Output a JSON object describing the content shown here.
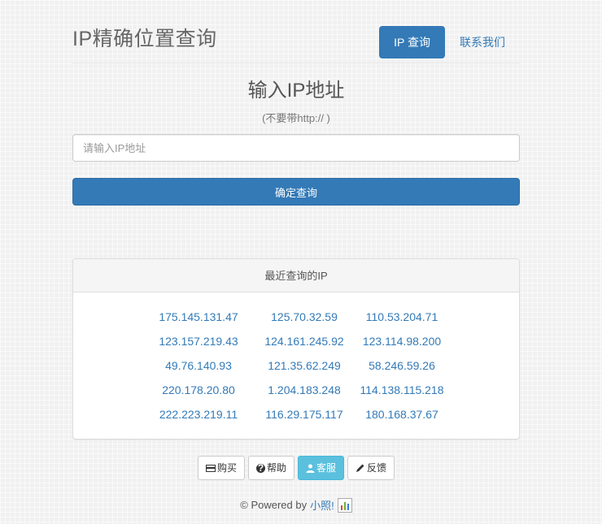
{
  "header": {
    "brand": "IP精确位置查询",
    "nav": [
      {
        "label": "IP 查询",
        "active": true
      },
      {
        "label": "联系我们",
        "active": false
      }
    ]
  },
  "form": {
    "title": "输入IP地址",
    "subtitle": "(不要带http:// )",
    "input_placeholder": "请输入IP地址",
    "input_value": "",
    "submit_label": "确定查询"
  },
  "recent": {
    "heading": "最近查询的IP",
    "ips": [
      "175.145.131.47",
      "125.70.32.59",
      "110.53.204.71",
      "123.157.219.43",
      "124.161.245.92",
      "123.114.98.200",
      "49.76.140.93",
      "121.35.62.249",
      "58.246.59.26",
      "220.178.20.80",
      "1.204.183.248",
      "114.138.115.218",
      "222.223.219.11",
      "116.29.175.117",
      "180.168.37.67"
    ]
  },
  "footer": {
    "buttons": {
      "buy": "购买",
      "help": "帮助",
      "service": "客服",
      "feedback": "反馈"
    },
    "powered_prefix": "© Powered by",
    "powered_link": "小照!"
  },
  "colors": {
    "primary": "#337ab7",
    "info": "#5bc0de"
  }
}
